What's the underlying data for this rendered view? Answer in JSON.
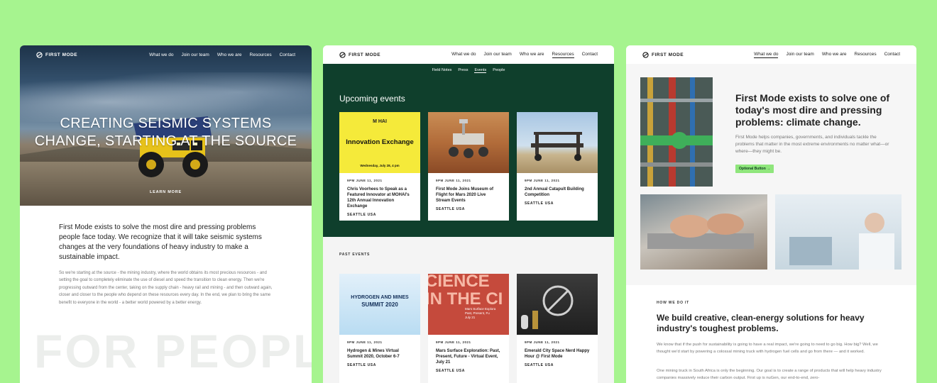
{
  "brand": "FIRST MODE",
  "colors": {
    "background": "#a6f48f",
    "forest": "#0f3f2c",
    "accent": "#8fe67c"
  },
  "panel_home": {
    "nav": [
      "What we do",
      "Join our team",
      "Who we are",
      "Resources",
      "Contact"
    ],
    "hero_title_line1": "CREATING SEISMIC SYSTEMS",
    "hero_title_line2": "CHANGE, STARTING AT THE SOURCE",
    "learn_more": "LEARN MORE",
    "lead": "First Mode exists to solve the most dire and pressing problems people face today. We recognize that it will take seismic systems changes at the very foundations of heavy industry to make a sustainable impact.",
    "body": "So we're starting at the source - the mining industry, where the world obtains its most precious resources - and setting the goal to completely eliminate the use of diesel and speed the transition to clean energy. Then we're progressing outward from the center, taking on the supply chain - heavy rail and mining - and then outward again, closer and closer to the people who depend on these resources every day. In the end, we plan to bring the same benefit to everyone in the world - a better world powered by a better energy.",
    "watermark": "FOR PEOPL"
  },
  "panel_events": {
    "nav": [
      "What we do",
      "Join our team",
      "Who we are",
      "Resources",
      "Contact"
    ],
    "subnav": [
      "Field Notes",
      "Press",
      "Events",
      "People"
    ],
    "upcoming_title": "Upcoming events",
    "upcoming": [
      {
        "date": "9PM JUNE 11, 2021",
        "title": "Chris Voorhees to Speak as a Featured Innovator at MOHAI's 12th Annual Innovation Exchange",
        "location": "SEATTLE USA"
      },
      {
        "date": "9PM JUNE 11, 2021",
        "title": "First Mode Joins Museum of Flight for Mars 2020 Live Stream Events",
        "location": "SEATTLE USA"
      },
      {
        "date": "9PM JUNE 11, 2021",
        "title": "2nd Annual Catapult Building Competition",
        "location": "SEATTLE USA"
      }
    ],
    "innov_img": {
      "org": "M  HAI",
      "name": "Innovation Exchange",
      "when": "Wednesday, July 28, 4 pm"
    },
    "past_label": "PAST EVENTS",
    "past": [
      {
        "date": "9PM JUNE 11, 2021",
        "title": "Hydrogen & Mines Virtual Summit 2020, October 6-7",
        "location": "SEATTLE USA"
      },
      {
        "date": "9PM JUNE 11, 2021",
        "title": "Mars Surface Exploration: Past, Present, Future - Virtual Event, July 21",
        "location": "SEATTLE USA"
      },
      {
        "date": "9PM JUNE 11, 2021",
        "title": "Emerald City Space Nerd Happy Hour @ First Mode",
        "location": "SEATTLE USA"
      }
    ],
    "hydro_img": {
      "line1": "HYDROGEN AND MINES",
      "line2": "SUMMIT 2020"
    },
    "science_img": {
      "big": "CIENCE\nIN THE CI",
      "sub": "Mars Surface Explora\nPast, Present, Fu\nJuly 21"
    }
  },
  "panel_about": {
    "nav": [
      "What we do",
      "Join our team",
      "Who we are",
      "Resources",
      "Contact"
    ],
    "heading": "First Mode exists to solve one of today's most dire and pressing problems: climate change.",
    "para": "First Mode helps companies, governments, and individuals tackle the problems that matter in the most extreme environments no matter what—or where—they might be.",
    "button": "Optional Button →",
    "how_label": "HOW WE DO IT",
    "how_heading": "We build creative, clean-energy solutions for heavy industry's toughest problems.",
    "body1": "We know that if the push for sustainability is going to have a real impact, we're going to need to go big. How big? Well, we thought we'd start by powering a colossal mining truck with hydrogen fuel cells and go from there — and it worked.",
    "body2": "One mining truck in South Africa is only the beginning. Our goal is to create a range of products that will help heavy industry companies massively reduce their carbon output. First up is nuGen, our end-to-end, zero-"
  }
}
